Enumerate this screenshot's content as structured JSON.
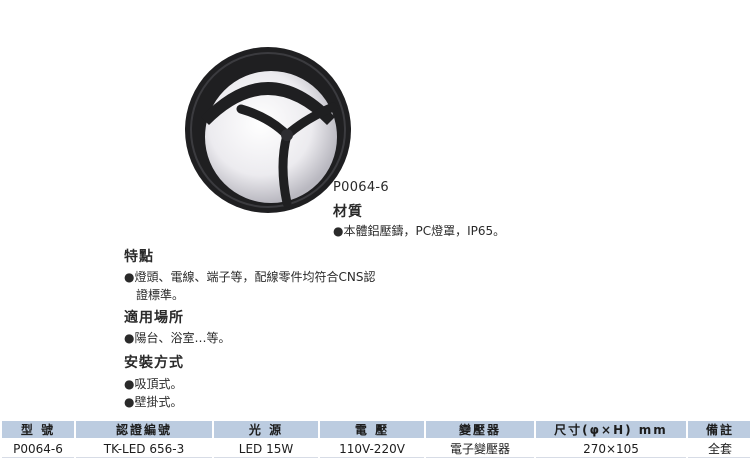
{
  "product": {
    "model": "P0064-6",
    "material_title": "材質",
    "material_items": [
      "●本體鋁壓鑄，PC燈罩，IP65。"
    ]
  },
  "features": {
    "title": "特點",
    "lines": [
      "●燈頭、電線、端子等，配線零件均符合CNS認",
      "證標準。"
    ]
  },
  "usage": {
    "title": "適用場所",
    "lines": [
      "●陽台、浴室…等。"
    ]
  },
  "installation": {
    "title": "安裝方式",
    "lines": [
      "●吸頂式。",
      "●壁掛式。"
    ]
  },
  "colors": {
    "header_bg": "#bccce0",
    "fixture_body": "#1f1f21",
    "diffuser": "#f2f2f4"
  },
  "spec_table": {
    "headers": [
      "型 號",
      "認證編號",
      "光 源",
      "電 壓",
      "變壓器",
      "尺寸(φ×H) mm",
      "備註"
    ],
    "row": [
      "P0064-6",
      "TK-LED 656-3",
      "LED 15W",
      "110V-220V",
      "電子變壓器",
      "270×105",
      "全套"
    ]
  }
}
